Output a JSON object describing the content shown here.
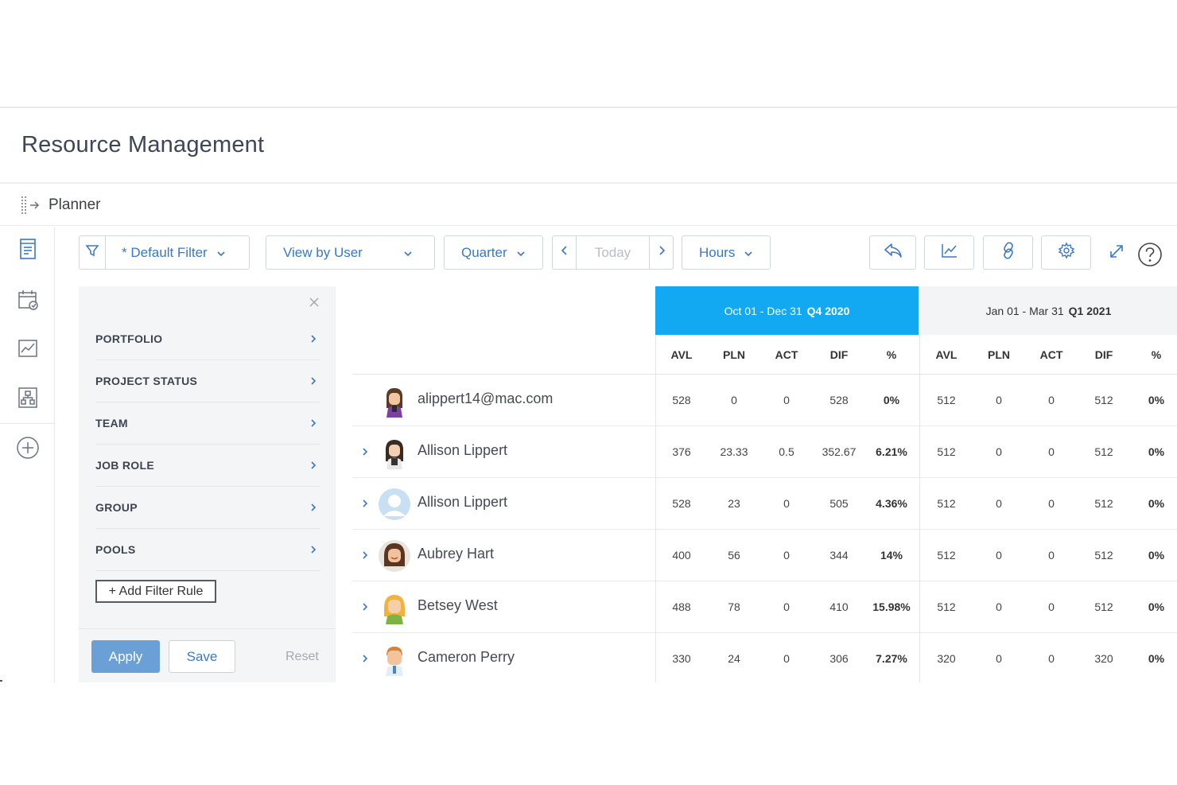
{
  "page": {
    "title": "Resource Management"
  },
  "planner": {
    "label": "Planner"
  },
  "leftnav": {
    "items": [
      {
        "icon": "document-icon"
      },
      {
        "icon": "calendar-icon"
      },
      {
        "icon": "chart-icon"
      },
      {
        "icon": "org-chart-icon"
      },
      {
        "icon": "add-circle-icon"
      }
    ]
  },
  "toolbar": {
    "filter_label": "* Default Filter",
    "view_label": "View by User",
    "period_label": "Quarter",
    "today_label": "Today",
    "unit_label": "Hours",
    "actions": [
      "undo-icon",
      "chart-icon",
      "link-icon",
      "gear-icon",
      "expand-icon",
      "help-icon"
    ]
  },
  "filter_panel": {
    "rows": [
      "PORTFOLIO",
      "PROJECT STATUS",
      "TEAM",
      "JOB ROLE",
      "GROUP",
      "POOLS"
    ],
    "add_rule_label": "+ Add Filter Rule",
    "apply_label": "Apply",
    "save_label": "Save",
    "reset_label": "Reset"
  },
  "grid": {
    "periods": [
      {
        "range": "Oct 01 - Dec 31",
        "quarter": "Q4 2020",
        "active": true
      },
      {
        "range": "Jan 01 - Mar 31",
        "quarter": "Q1 2021",
        "active": false
      }
    ],
    "columns": [
      "AVL",
      "PLN",
      "ACT",
      "DIF",
      "%"
    ],
    "rows": [
      {
        "name": "alippert14@mac.com",
        "expandable": false,
        "avatar": "female-avatar-purple",
        "q4": [
          "528",
          "0",
          "0",
          "528",
          "0%"
        ],
        "q1": [
          "512",
          "0",
          "0",
          "512",
          "0%"
        ]
      },
      {
        "name": "Allison Lippert",
        "expandable": true,
        "avatar": "female-avatar-dark",
        "q4": [
          "376",
          "23.33",
          "0.5",
          "352.67",
          "6.21%"
        ],
        "q1": [
          "512",
          "0",
          "0",
          "512",
          "0%"
        ]
      },
      {
        "name": "Allison Lippert",
        "expandable": true,
        "avatar": "placeholder-avatar",
        "q4": [
          "528",
          "23",
          "0",
          "505",
          "4.36%"
        ],
        "q1": [
          "512",
          "0",
          "0",
          "512",
          "0%"
        ]
      },
      {
        "name": "Aubrey Hart",
        "expandable": true,
        "avatar": "female-avatar-brown",
        "q4": [
          "400",
          "56",
          "0",
          "344",
          "14%"
        ],
        "q1": [
          "512",
          "0",
          "0",
          "512",
          "0%"
        ]
      },
      {
        "name": "Betsey West",
        "expandable": true,
        "avatar": "female-avatar-blonde",
        "q4": [
          "488",
          "78",
          "0",
          "410",
          "15.98%"
        ],
        "q1": [
          "512",
          "0",
          "0",
          "512",
          "0%"
        ]
      },
      {
        "name": "Cameron Perry",
        "expandable": true,
        "avatar": "male-avatar",
        "q4": [
          "330",
          "24",
          "0",
          "306",
          "7.27%"
        ],
        "q1": [
          "320",
          "0",
          "0",
          "320",
          "0%"
        ]
      }
    ]
  },
  "colors": {
    "accent": "#12a9f2",
    "link": "#3a78c6",
    "apply": "#6aa0d6"
  }
}
